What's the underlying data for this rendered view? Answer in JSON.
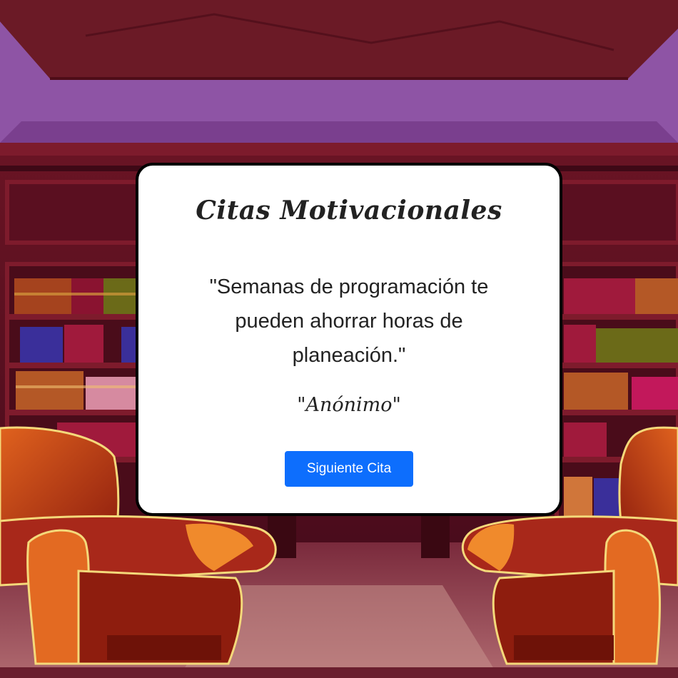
{
  "card": {
    "title": "Citas Motivacionales",
    "quote": "\"Semanas de programación te pueden ahorrar horas de planeación.\"",
    "author": "\"Anónimo\"",
    "next_button_label": "Siguiente Cita"
  },
  "colors": {
    "button": "#0d6efd",
    "card_background": "#ffffff",
    "card_border": "#000000",
    "ceiling_purple": "#8e54a5",
    "wall_maroon": "#5c1020",
    "armchair_orange": "#c2410c"
  },
  "background": {
    "scene": "library-room-illustration",
    "icons": [
      "bookshelf-icon",
      "armchair-icon"
    ]
  }
}
